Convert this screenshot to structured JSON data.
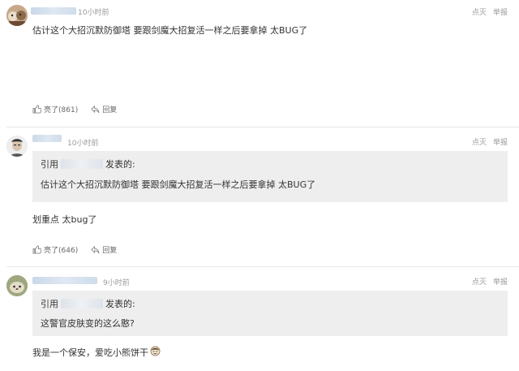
{
  "actions": {
    "like_label": "点灭",
    "report_label": "举报",
    "reply_label": "回复"
  },
  "quote": {
    "prefix": "引用",
    "suffix": "发表的:"
  },
  "comments": [
    {
      "time": "10小时前",
      "text": "估计这个大招沉默防御塔 要跟剑魔大招复活一样之后要拿掉 太BUG了",
      "likes": "亮了(861)",
      "avatar": "avatar-dogs"
    },
    {
      "time": "10小时前",
      "quote_text": "估计这个大招沉默防御塔 要跟剑魔大招复活一样之后要拿掉 太BUG了",
      "text": "划重点 太bug了",
      "likes": "亮了(646)",
      "avatar": "avatar-portrait"
    },
    {
      "time": "9小时前",
      "quote_text": "这警官皮肤变的这么憨?",
      "text": "我是一个保安，爱吃小熊饼干",
      "emoji": "smug-face-emoji",
      "avatar": "avatar-animal"
    }
  ]
}
